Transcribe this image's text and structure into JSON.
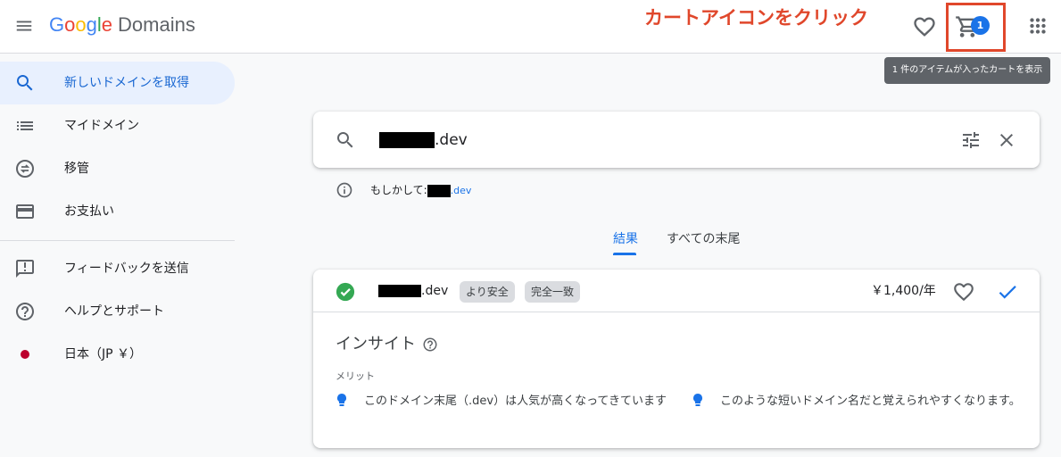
{
  "header": {
    "logo_letters": [
      "G",
      "o",
      "o",
      "g",
      "l",
      "e"
    ],
    "logo_product": "Domains",
    "annotation": "カートアイコンをクリック",
    "cart_count": "1",
    "cart_tooltip": "1 件のアイテムが入ったカートを表示"
  },
  "sidebar": {
    "items": [
      {
        "label": "新しいドメインを取得",
        "icon": "search-icon"
      },
      {
        "label": "マイドメイン",
        "icon": "list-icon"
      },
      {
        "label": "移管",
        "icon": "transfer-icon"
      },
      {
        "label": "お支払い",
        "icon": "credit-card-icon"
      },
      {
        "label": "フィードバックを送信",
        "icon": "feedback-icon"
      },
      {
        "label": "ヘルプとサポート",
        "icon": "help-icon"
      },
      {
        "label": "日本（JP ￥）",
        "icon": "japan-flag-icon"
      }
    ]
  },
  "search": {
    "query_suffix": ".dev"
  },
  "suggestion": {
    "prefix": "もしかして:",
    "link_suffix": ".dev"
  },
  "tabs": [
    {
      "label": "結果"
    },
    {
      "label": "すべての末尾"
    }
  ],
  "result": {
    "domain_suffix": ".dev",
    "chips": [
      "より安全",
      "完全一致"
    ],
    "price": "￥1,400/年"
  },
  "insight": {
    "title": "インサイト",
    "merit_label": "メリット",
    "points": [
      "このドメイン末尾（.dev）は人気が高くなってきています",
      "このような短いドメイン名だと覚えられやすくなります。"
    ]
  },
  "colors": {
    "accent": "#1a73e8",
    "annotation": "#e0472b",
    "success": "#34a853"
  }
}
